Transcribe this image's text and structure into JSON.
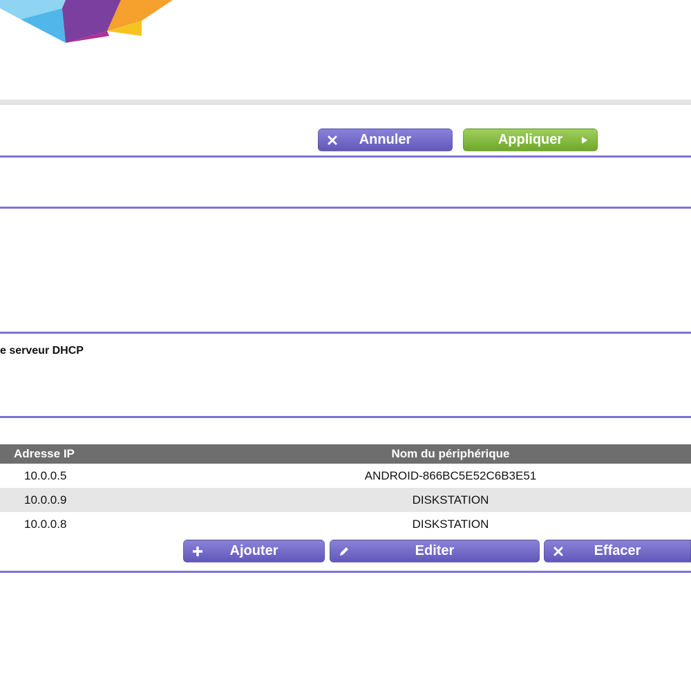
{
  "toolbar": {
    "cancel_label": "Annuler",
    "apply_label": "Appliquer"
  },
  "dhcp": {
    "section_label": "e serveur DHCP"
  },
  "reservation_table": {
    "headers": [
      "Adresse IP",
      "Nom du périphérique"
    ],
    "rows": [
      {
        "ip": "10.0.0.5",
        "name": "ANDROID-866BC5E52C6B3E51"
      },
      {
        "ip": "10.0.0.9",
        "name": "DISKSTATION"
      },
      {
        "ip": "10.0.0.8",
        "name": "DISKSTATION"
      }
    ]
  },
  "table_actions": {
    "add_label": "Ajouter",
    "edit_label": "Editer",
    "delete_label": "Effacer"
  },
  "colors": {
    "accent_purple": "#7b73d8",
    "button_purple": "#6d64c6",
    "button_green": "#86bd44",
    "table_header": "#6e6e6e",
    "row_alt": "#e6e6e6"
  },
  "icons": [
    "close-icon",
    "play-arrow-icon",
    "plus-icon",
    "pencil-icon"
  ]
}
